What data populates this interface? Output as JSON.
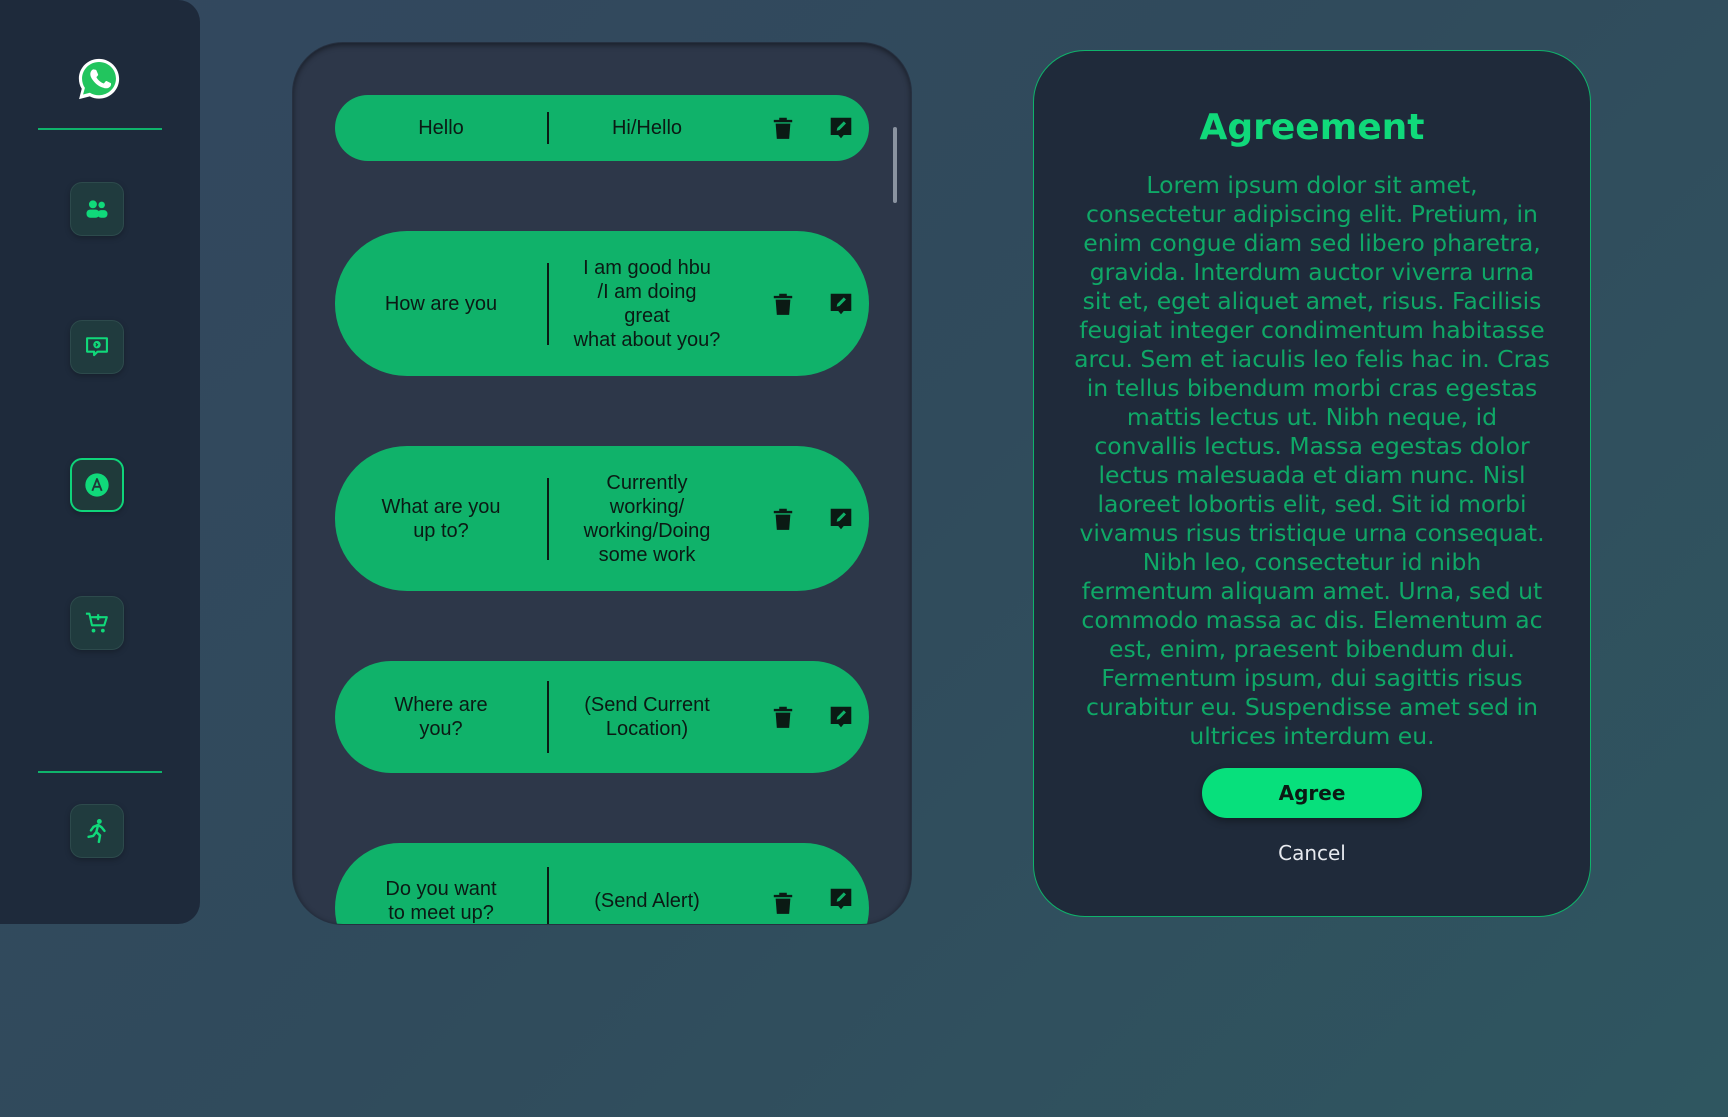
{
  "sidebar": {
    "logo": "whatsapp-logo",
    "items": [
      {
        "name": "contacts",
        "icon": "users-icon",
        "active": false
      },
      {
        "name": "messages",
        "icon": "chat-bubble-icon",
        "active": false
      },
      {
        "name": "autoreply",
        "icon": "letter-a-circle-icon",
        "active": true
      },
      {
        "name": "shop",
        "icon": "cart-icon",
        "active": false
      }
    ],
    "footer_item": {
      "name": "exit",
      "icon": "running-person-icon"
    }
  },
  "faq_rows": [
    {
      "question": "Hello",
      "answer": "Hi/Hello"
    },
    {
      "question": "How are you",
      "answer": "I am good hbu\n/I am doing\ngreat\nwhat about you?"
    },
    {
      "question": "What are you\nup to?",
      "answer": "Currently\nworking/\nworking/Doing\nsome work"
    },
    {
      "question": "Where are\nyou?",
      "answer": "(Send Current\nLocation)"
    },
    {
      "question": "Do you want\nto meet up?",
      "answer": "(Send Alert)"
    }
  ],
  "agreement": {
    "title": "Agreement",
    "body": "Lorem ipsum dolor sit amet, consectetur adipiscing elit. Pretium, in enim congue diam sed libero pharetra, gravida. Interdum auctor viverra urna sit et, eget aliquet amet, risus. Facilisis feugiat integer condimentum habitasse arcu. Sem et iaculis leo felis hac in. Cras in tellus bibendum morbi cras egestas mattis lectus ut. Nibh neque, id convallis lectus. Massa egestas dolor lectus malesuada et diam nunc. Nisl laoreet lobortis elit, sed. Sit id morbi vivamus risus tristique urna consequat. Nibh leo, consectetur id nibh fermentum aliquam amet. Urna, sed ut commodo massa ac dis. Elementum ac est, enim, praesent bibendum dui. Fermentum ipsum, dui sagittis risus curabitur eu. Suspendisse amet sed in ultrices interdum eu.",
    "agree_label": "Agree",
    "cancel_label": "Cancel"
  },
  "colors": {
    "accent": "#10b26a",
    "accent_bright": "#07e07c",
    "panel": "#1f2a3a",
    "background": "#33475e"
  }
}
